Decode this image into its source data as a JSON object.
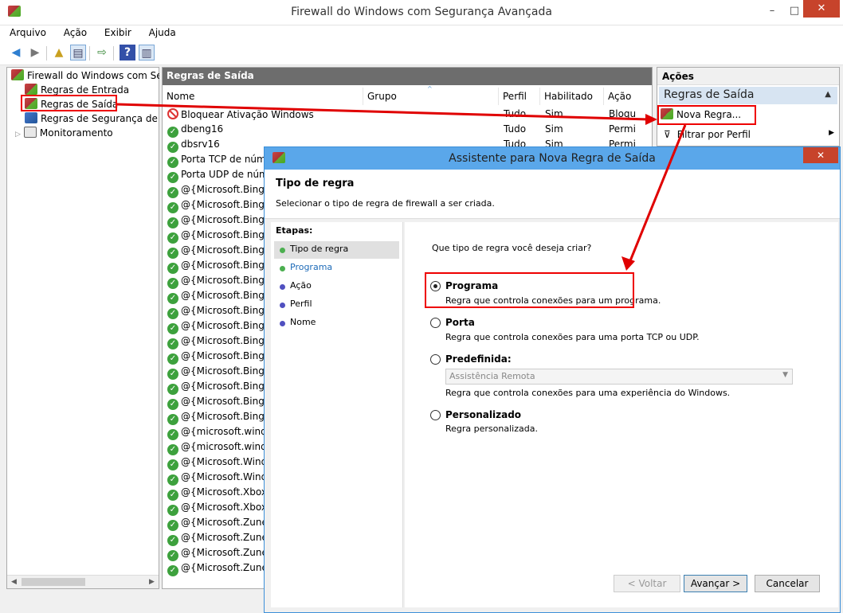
{
  "window": {
    "title": "Firewall do Windows com Segurança Avançada",
    "minimize": "–",
    "maximize": "□",
    "close": "✕"
  },
  "menu": [
    "Arquivo",
    "Ação",
    "Exibir",
    "Ajuda"
  ],
  "tree": {
    "root": "Firewall do Windows com Segurança Avançada",
    "items": [
      "Regras de Entrada",
      "Regras de Saída",
      "Regras de Segurança de Conexão",
      "Monitoramento"
    ]
  },
  "list": {
    "title": "Regras de Saída",
    "columns": [
      "Nome",
      "Grupo",
      "Perfil",
      "Habilitado",
      "Ação"
    ],
    "rows": [
      {
        "name": "Bloquear Ativação Windows",
        "perfil": "Tudo",
        "hab": "Sim",
        "acao": "Bloqu",
        "type": "block"
      },
      {
        "name": "dbeng16",
        "perfil": "Tudo",
        "hab": "Sim",
        "acao": "Permi",
        "type": "allow"
      },
      {
        "name": "dbsrv16",
        "perfil": "Tudo",
        "hab": "Sim",
        "acao": "Permi",
        "type": "allow"
      },
      {
        "name": "Porta TCP de núme",
        "perfil": "",
        "hab": "",
        "acao": "",
        "type": "allow"
      },
      {
        "name": "Porta UDP de núme",
        "perfil": "",
        "hab": "",
        "acao": "",
        "type": "allow"
      },
      {
        "name": "@{Microsoft.BingFi",
        "perfil": "",
        "hab": "",
        "acao": "",
        "type": "allow"
      },
      {
        "name": "@{Microsoft.BingFi",
        "perfil": "",
        "hab": "",
        "acao": "",
        "type": "allow"
      },
      {
        "name": "@{Microsoft.BingFo",
        "perfil": "",
        "hab": "",
        "acao": "",
        "type": "allow"
      },
      {
        "name": "@{Microsoft.BingFo",
        "perfil": "",
        "hab": "",
        "acao": "",
        "type": "allow"
      },
      {
        "name": "@{Microsoft.BingH",
        "perfil": "",
        "hab": "",
        "acao": "",
        "type": "allow"
      },
      {
        "name": "@{Microsoft.BingH",
        "perfil": "",
        "hab": "",
        "acao": "",
        "type": "allow"
      },
      {
        "name": "@{Microsoft.BingM",
        "perfil": "",
        "hab": "",
        "acao": "",
        "type": "allow"
      },
      {
        "name": "@{Microsoft.BingM",
        "perfil": "",
        "hab": "",
        "acao": "",
        "type": "allow"
      },
      {
        "name": "@{Microsoft.BingN",
        "perfil": "",
        "hab": "",
        "acao": "",
        "type": "allow"
      },
      {
        "name": "@{Microsoft.BingN",
        "perfil": "",
        "hab": "",
        "acao": "",
        "type": "allow"
      },
      {
        "name": "@{Microsoft.BingSp",
        "perfil": "",
        "hab": "",
        "acao": "",
        "type": "allow"
      },
      {
        "name": "@{Microsoft.BingSp",
        "perfil": "",
        "hab": "",
        "acao": "",
        "type": "allow"
      },
      {
        "name": "@{Microsoft.BingTr",
        "perfil": "",
        "hab": "",
        "acao": "",
        "type": "allow"
      },
      {
        "name": "@{Microsoft.BingTr",
        "perfil": "",
        "hab": "",
        "acao": "",
        "type": "allow"
      },
      {
        "name": "@{Microsoft.BingW",
        "perfil": "",
        "hab": "",
        "acao": "",
        "type": "allow"
      },
      {
        "name": "@{Microsoft.BingW",
        "perfil": "",
        "hab": "",
        "acao": "",
        "type": "allow"
      },
      {
        "name": "@{microsoft.windo",
        "perfil": "",
        "hab": "",
        "acao": "",
        "type": "allow"
      },
      {
        "name": "@{microsoft.windo",
        "perfil": "",
        "hab": "",
        "acao": "",
        "type": "allow"
      },
      {
        "name": "@{Microsoft.Windo",
        "perfil": "",
        "hab": "",
        "acao": "",
        "type": "allow"
      },
      {
        "name": "@{Microsoft.Windo",
        "perfil": "",
        "hab": "",
        "acao": "",
        "type": "allow"
      },
      {
        "name": "@{Microsoft.XboxLI",
        "perfil": "",
        "hab": "",
        "acao": "",
        "type": "allow"
      },
      {
        "name": "@{Microsoft.XboxLI",
        "perfil": "",
        "hab": "",
        "acao": "",
        "type": "allow"
      },
      {
        "name": "@{Microsoft.ZuneM",
        "perfil": "",
        "hab": "",
        "acao": "",
        "type": "allow"
      },
      {
        "name": "@{Microsoft.ZuneM",
        "perfil": "",
        "hab": "",
        "acao": "",
        "type": "allow"
      },
      {
        "name": "@{Microsoft.ZuneV",
        "perfil": "",
        "hab": "",
        "acao": "",
        "type": "allow"
      },
      {
        "name": "@{Microsoft.ZuneV",
        "perfil": "",
        "hab": "",
        "acao": "",
        "type": "allow"
      }
    ]
  },
  "actions": {
    "header": "Ações",
    "section": "Regras de Saída",
    "items": [
      "Nova Regra...",
      "Filtrar por Perfil"
    ]
  },
  "dialog": {
    "title": "Assistente para Nova Regra de Saída",
    "heading": "Tipo de regra",
    "subheading": "Selecionar o tipo de regra de firewall a ser criada.",
    "steps_label": "Etapas:",
    "steps": [
      "Tipo de regra",
      "Programa",
      "Ação",
      "Perfil",
      "Nome"
    ],
    "question": "Que tipo de regra você deseja criar?",
    "options": [
      {
        "label": "Programa",
        "desc": "Regra que controla conexões para um programa.",
        "selected": true
      },
      {
        "label": "Porta",
        "desc": "Regra que controla conexões para uma porta TCP ou UDP.",
        "selected": false
      },
      {
        "label": "Predefinida:",
        "desc": "Regra que controla conexões para uma experiência do Windows.",
        "selected": false
      },
      {
        "label": "Personalizado",
        "desc": "Regra personalizada.",
        "selected": false
      }
    ],
    "predefined_value": "Assistência Remota",
    "buttons": {
      "back": "< Voltar",
      "next": "Avançar >",
      "cancel": "Cancelar"
    }
  },
  "colors": {
    "accent": "#5aa7ea",
    "highlight": "#e00000",
    "allow": "#3da13d",
    "block": "#dd3333"
  }
}
